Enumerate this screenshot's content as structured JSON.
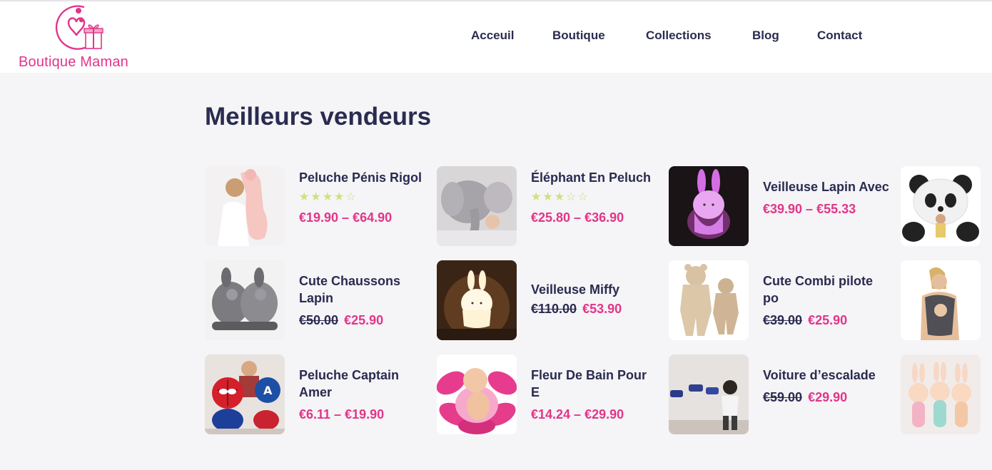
{
  "brand": {
    "name": "Boutique Maman",
    "accent": "#e2358a",
    "text": "#2a2b50"
  },
  "nav": [
    {
      "label": "Acceuil",
      "active": true
    },
    {
      "label": "Boutique",
      "active": false
    },
    {
      "label": "Collections",
      "active": false
    },
    {
      "label": "Blog",
      "active": false
    },
    {
      "label": "Contact",
      "active": false
    }
  ],
  "section": {
    "title": "Meilleurs vendeurs"
  },
  "products": [
    {
      "name": "Peluche Pénis Rigol",
      "rating": 4,
      "price": "€19.90 – €64.90",
      "old_price": "",
      "image": "girl-hugging-pink-plush"
    },
    {
      "name": "Éléphant En Peluch",
      "rating": 3,
      "price": "€25.80 – €36.90",
      "old_price": "",
      "image": "grey-elephant-plush"
    },
    {
      "name": "Veilleuse Lapin Avec",
      "rating": null,
      "price": "€39.90 – €55.33",
      "old_price": "",
      "image": "pink-bunny-nightlight"
    },
    {
      "name": "",
      "rating": null,
      "price": "",
      "old_price": "",
      "image": "giant-panda-plush"
    },
    {
      "name": "Cute Chaussons Lapin",
      "rating": null,
      "price": "€25.90",
      "old_price": "€50.00",
      "image": "grey-bunny-slippers"
    },
    {
      "name": "Veilleuse Miffy",
      "rating": null,
      "price": "€53.90",
      "old_price": "€110.00",
      "image": "miffy-lamp"
    },
    {
      "name": "Cute Combi pilote po",
      "rating": null,
      "price": "€25.90",
      "old_price": "€39.00",
      "image": "beige-baby-onesies"
    },
    {
      "name": "",
      "rating": null,
      "price": "",
      "old_price": "",
      "image": "mother-baby-carrier"
    },
    {
      "name": "Peluche Captain Amer",
      "rating": null,
      "price": "€6.11 – €19.90",
      "old_price": "",
      "image": "superhero-plushes"
    },
    {
      "name": "Fleur De Bain Pour E",
      "rating": null,
      "price": "€14.24 – €29.90",
      "old_price": "",
      "image": "baby-in-pink-flower-bath"
    },
    {
      "name": "Voiture d’escalade",
      "rating": null,
      "price": "€29.90",
      "old_price": "€59.00",
      "image": "wall-climbing-car"
    },
    {
      "name": "",
      "rating": null,
      "price": "",
      "old_price": "",
      "image": "bunny-rattles"
    }
  ]
}
